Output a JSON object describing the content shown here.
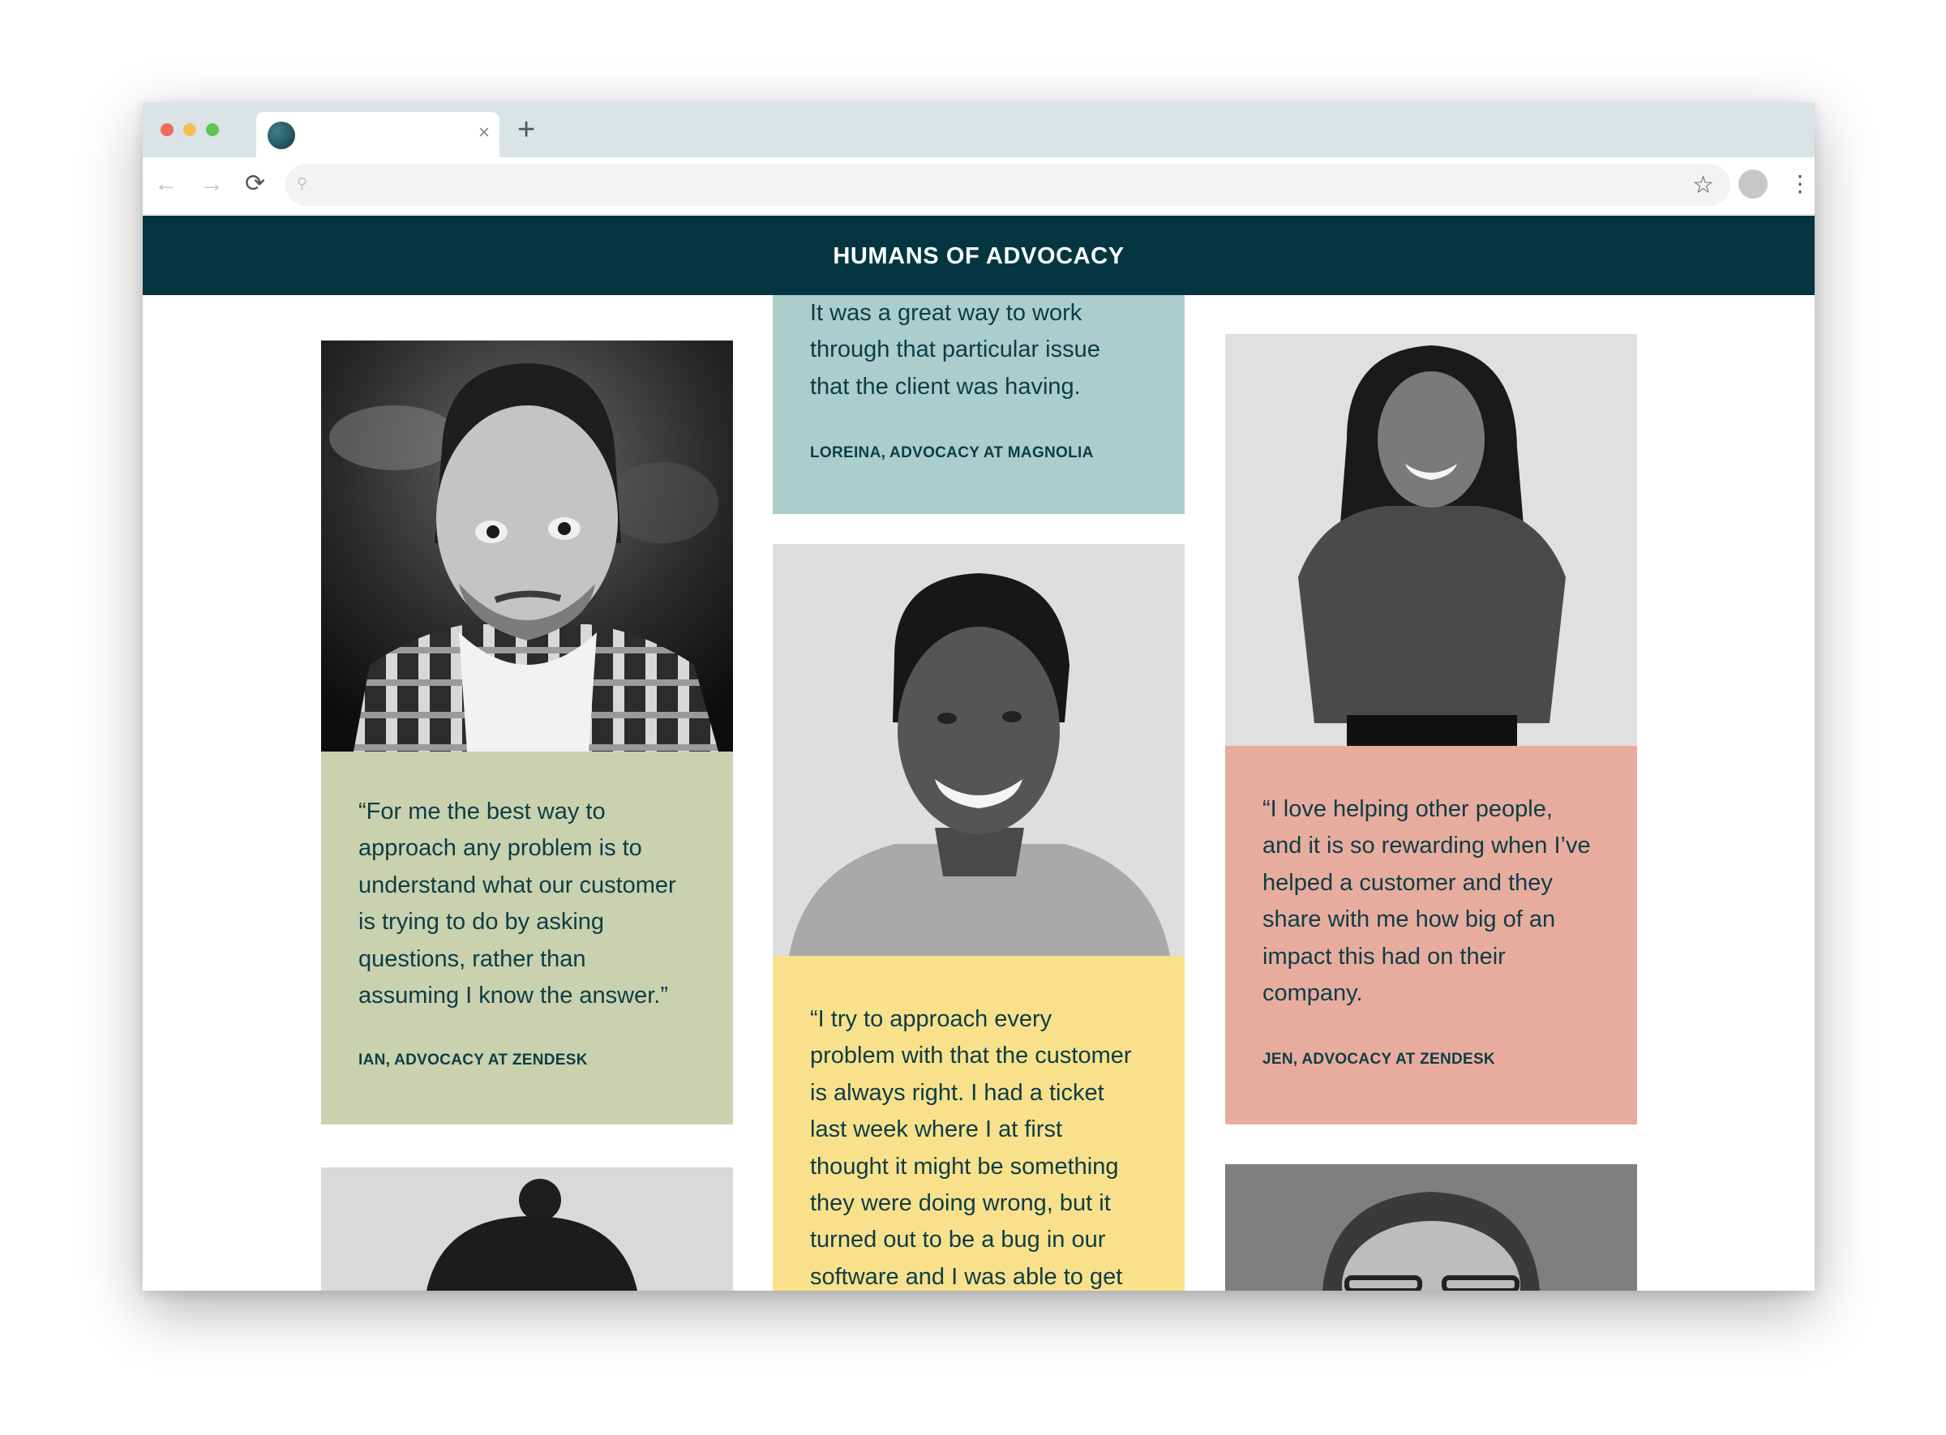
{
  "site": {
    "title": "HUMANS OF ADVOCACY"
  },
  "browser": {
    "tab_close": "×",
    "new_tab": "+",
    "back_icon": "←",
    "forward_icon": "→",
    "reload_icon": "⟳",
    "search_icon": "⚲",
    "bookmark_icon": "☆",
    "menu_icon": "⋮"
  },
  "colors": {
    "header_bg": "#033641",
    "text": "#0d3d45",
    "teal_card": "#abcdcc",
    "green_card": "#cad1af",
    "yellow_card": "#f9e18c",
    "pink_card": "#e8ac9f"
  },
  "cards": {
    "loreina": {
      "quote_lines": [
        "It was a great way to work",
        "through that particular issue",
        "that the client was having."
      ],
      "author": "LOREINA, ADVOCACY AT MAGNOLIA"
    },
    "ian": {
      "quote_lines": [
        "“For me the best way to",
        "approach any problem is to",
        "understand what our customer",
        "is trying to do by asking",
        "questions, rather than",
        "assuming I know the answer.”"
      ],
      "author": "IAN, ADVOCACY AT ZENDESK"
    },
    "yellow": {
      "quote_lines": [
        "“I try to approach every",
        "problem with that the customer",
        "is always right. I had a ticket",
        "last week where I at first",
        "thought it might be something",
        "they were doing wrong, but it",
        "turned out to be a bug in our",
        "software and I was able to get"
      ]
    },
    "jen": {
      "quote_lines": [
        "“I love helping other people,",
        "and it is so rewarding when I’ve",
        "helped a customer and they",
        "share with me how big of an",
        "impact this had on their",
        "company."
      ],
      "author": "JEN, ADVOCACY AT ZENDESK"
    }
  }
}
